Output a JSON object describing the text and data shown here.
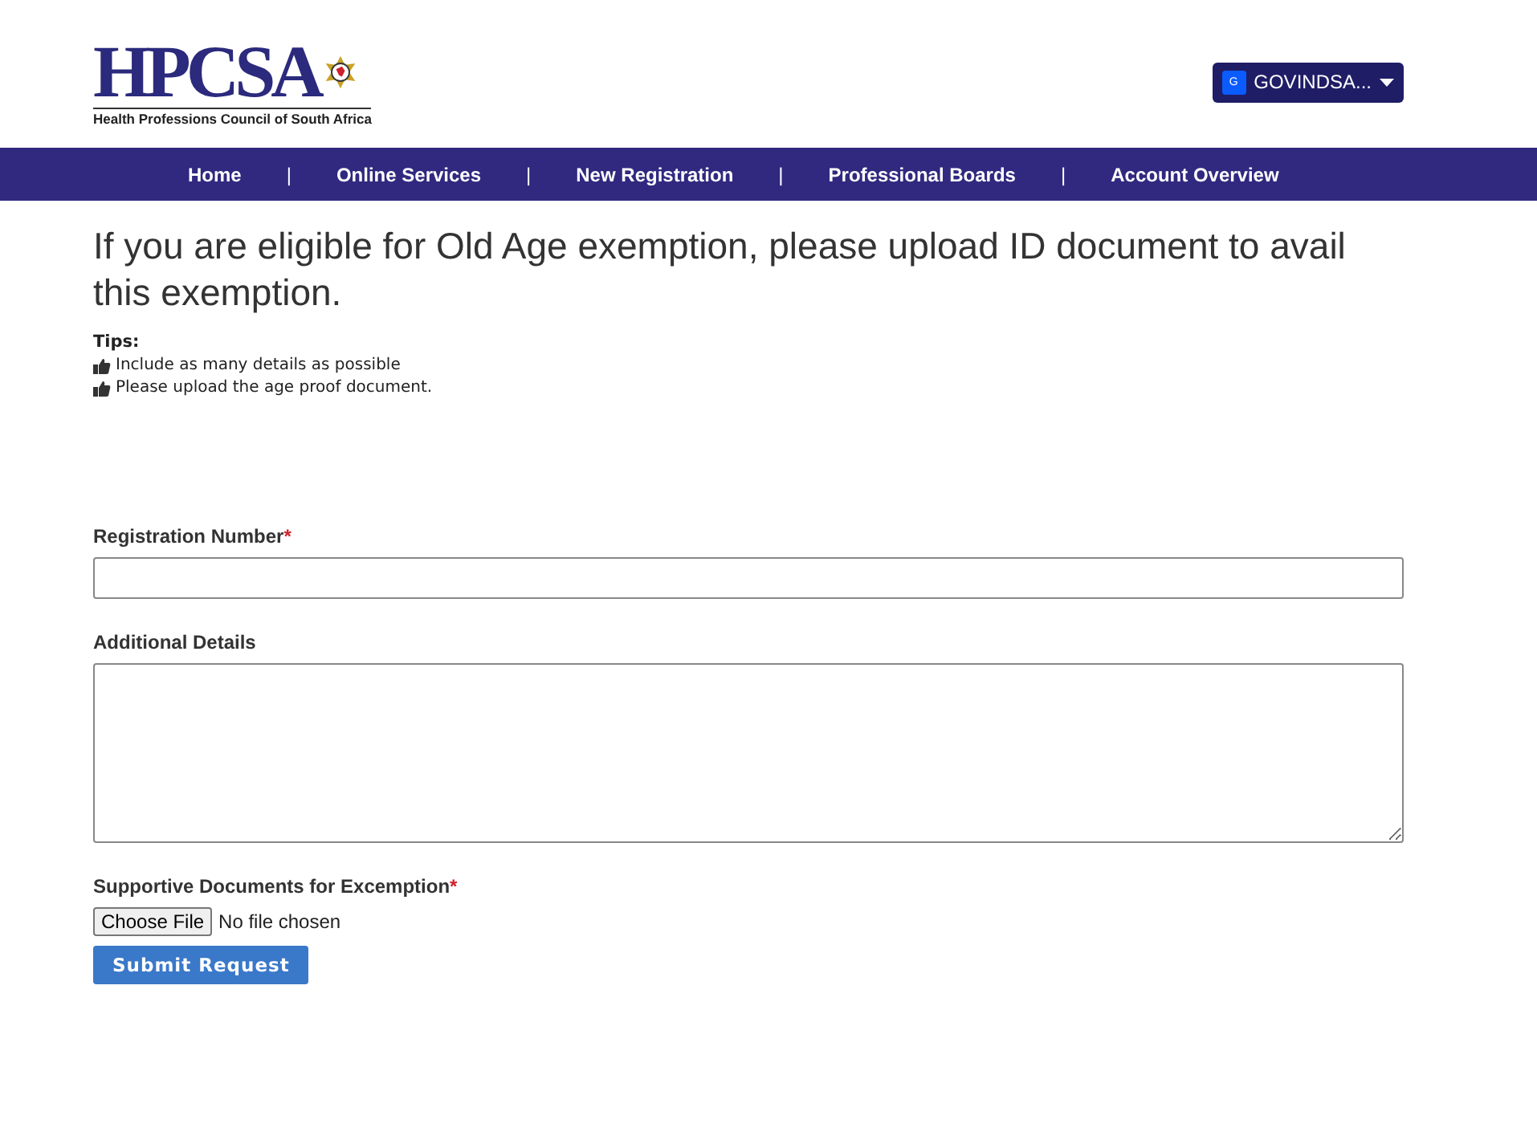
{
  "logo": {
    "letters": "HPCSA",
    "subtitle": "Health Professions Council of South Africa"
  },
  "user_menu": {
    "avatar": "G",
    "label": "GOVINDSA..."
  },
  "nav": {
    "separator": "|",
    "items": [
      {
        "label": "Home"
      },
      {
        "label": "Online Services"
      },
      {
        "label": "New Registration"
      },
      {
        "label": "Professional Boards"
      },
      {
        "label": "Account Overview"
      }
    ]
  },
  "heading": "If you are eligible for Old Age exemption, please upload ID document to avail this exemption.",
  "tips": {
    "title": "Tips:",
    "items": [
      "Include as many details as possible",
      "Please upload the age proof document."
    ]
  },
  "form": {
    "fields": [
      {
        "kind": "text",
        "label": "Registration Number",
        "required": true
      },
      {
        "kind": "textarea",
        "label": "Additional Details",
        "required": false
      },
      {
        "kind": "file",
        "label": "Supportive Documents for Excemption",
        "required": true,
        "button": "Choose File",
        "status": "No file chosen"
      }
    ],
    "required_mark": "*",
    "submit": "Submit Request"
  }
}
